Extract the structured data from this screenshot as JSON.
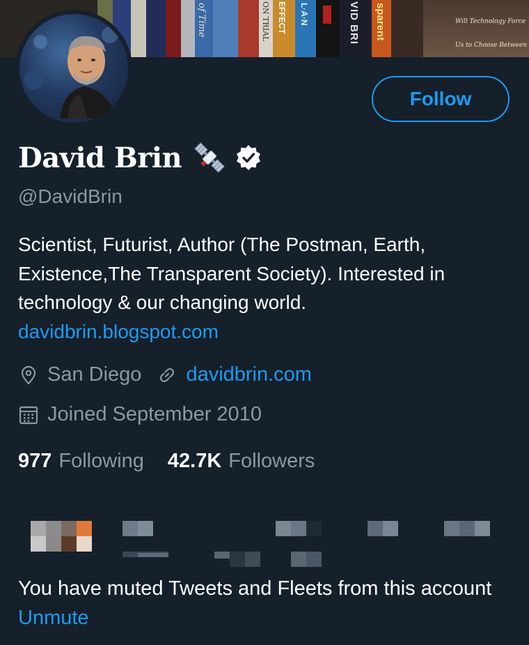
{
  "profile": {
    "name": "David Brin",
    "handle": "@DavidBrin",
    "bio_text": "Scientist, Futurist, Author (The Postman, Earth, Existence,The Transparent Society). Interested in technology & our changing world.",
    "bio_link": "davidbrin.blogspot.com",
    "location": "San Diego",
    "website": "davidbrin.com",
    "joined": "Joined September 2010",
    "following_count": "977",
    "following_label": "Following",
    "followers_count": "42.7K",
    "followers_label": "Followers"
  },
  "actions": {
    "follow_label": "Follow"
  },
  "banner": {
    "book_spine_texts": [
      "of Time",
      "ON TRIAL",
      "EFFECT",
      "L·A·N",
      "VID BRI",
      "sparent"
    ],
    "poster_texts": [
      "Will Technology Force",
      "Us to Choose Between"
    ]
  },
  "muted_notice": {
    "text": "You have muted Tweets and Fleets from this account",
    "action_label": "Unmute"
  },
  "icons": {
    "location": "location-pin-icon",
    "website": "link-icon",
    "joined": "calendar-icon",
    "verified": "verified-badge-icon",
    "emoji": "satellite-emoji-icon"
  },
  "colors": {
    "background": "#15202b",
    "accent": "#1d9bf0",
    "secondary_text": "#8b98a5"
  }
}
